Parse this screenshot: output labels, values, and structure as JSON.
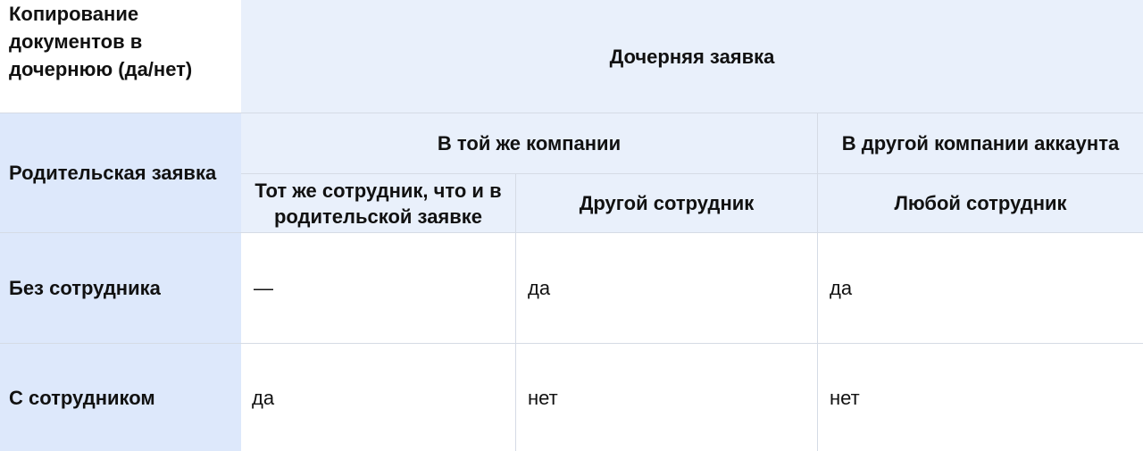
{
  "table": {
    "corner_label": "Копирование документов в дочернюю (да/нет)",
    "child_request_header": "Дочерняя заявка",
    "parent_request_header": "Родительская заявка",
    "groups": {
      "same_company": "В той же компании",
      "other_company": "В другой компании аккаунта"
    },
    "subheaders": {
      "same_employee": "Тот же сотрудник, что и в родительской заявке",
      "other_employee": "Другой сотрудник",
      "any_employee": "Любой сотрудник"
    },
    "rows": [
      {
        "label": "Без сотрудника",
        "values": [
          "—",
          "да",
          "да"
        ]
      },
      {
        "label": "С сотрудником",
        "values": [
          "да",
          "нет",
          "нет"
        ]
      }
    ]
  }
}
